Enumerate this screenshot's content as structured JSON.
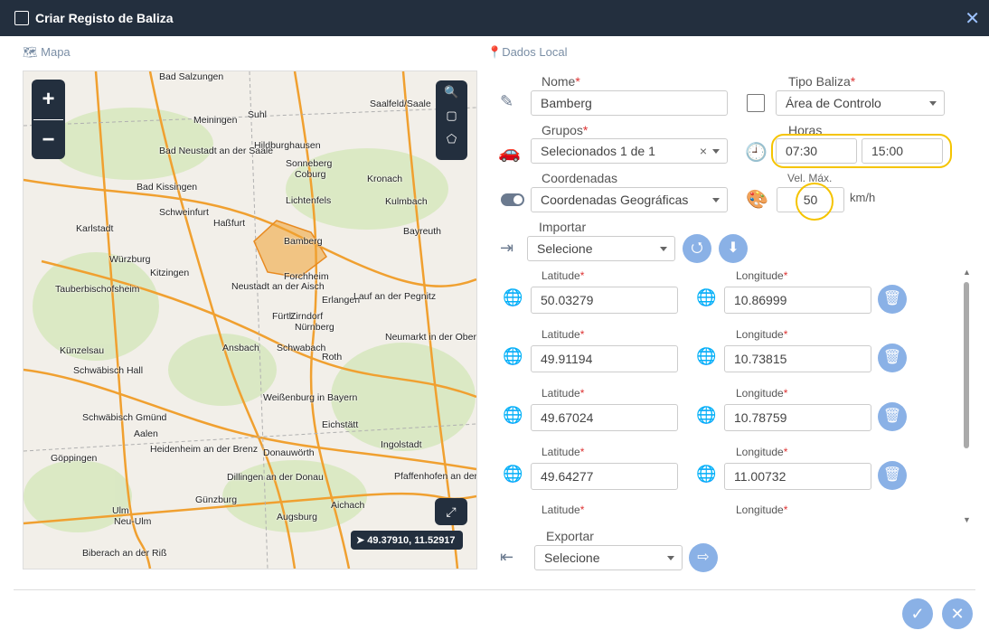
{
  "window": {
    "title": "Criar Registo de Baliza",
    "close_glyph": "✕"
  },
  "sections": {
    "map": "Mapa",
    "local": "Dados Local"
  },
  "map": {
    "coords": "49.37910, 11.52917",
    "labels": [
      "Bad Salzungen",
      "Suhl",
      "Saalfeld/Saale",
      "Meiningen",
      "Hildburghausen",
      "Bad Neustadt an der Saale",
      "Sonneberg",
      "Coburg",
      "Kronach",
      "Bad Kissingen",
      "Lichtenfels",
      "Kulmbach",
      "Schweinfurt",
      "Haßfurt",
      "Karlstadt",
      "Bamberg",
      "Bayreuth",
      "Würzburg",
      "Kitzingen",
      "Forchheim",
      "Tauberbischofsheim",
      "Neustadt an der Aisch",
      "Erlangen",
      "Lauf an der Pegnitz",
      "Fürth",
      "Zirndorf",
      "Nürnberg",
      "Künzelsau",
      "Ansbach",
      "Schwabach",
      "Neumarkt in der Oberpfalz",
      "Schwäbisch Hall",
      "Roth",
      "Weißenburg in Bayern",
      "Schwäbisch Gmünd",
      "Aalen",
      "Eichstätt",
      "Göppingen",
      "Heidenheim an der Brenz",
      "Donauwörth",
      "Ingolstadt",
      "Dillingen an der Donau",
      "Pfaffenhofen an der Ilm",
      "Günzburg",
      "Ulm",
      "Neu-Ulm",
      "Aichach",
      "Augsburg",
      "Biberach an der Riß"
    ]
  },
  "form": {
    "nome_label": "Nome",
    "nome_value": "Bamberg",
    "tipo_label": "Tipo Baliza",
    "tipo_value": "Área de Controlo",
    "grupos_label": "Grupos",
    "grupos_value": "Selecionados 1 de 1",
    "grupos_clear": "×",
    "horas_label": "Horas",
    "hora_inicio": "07:30",
    "hora_fim": "15:00",
    "coord_label": "Coordenadas",
    "coord_value": "Coordenadas Geográficas",
    "vel_label": "Vel. Máx.",
    "vel_value": "50",
    "vel_unit": "km/h",
    "importar_label": "Importar",
    "importar_value": "Selecione",
    "exportar_label": "Exportar",
    "exportar_value": "Selecione",
    "lat_label": "Latitude",
    "lon_label": "Longitude",
    "req_mark": "*"
  },
  "points": [
    {
      "lat": "50.03279",
      "lon": "10.86999"
    },
    {
      "lat": "49.91194",
      "lon": "10.73815"
    },
    {
      "lat": "49.67024",
      "lon": "10.78759"
    },
    {
      "lat": "49.64277",
      "lon": "11.00732"
    },
    {
      "lat": "",
      "lon": ""
    }
  ],
  "colors": {
    "header": "#232f3e",
    "accent": "#8ab1e6",
    "highlight": "#f5c400"
  }
}
